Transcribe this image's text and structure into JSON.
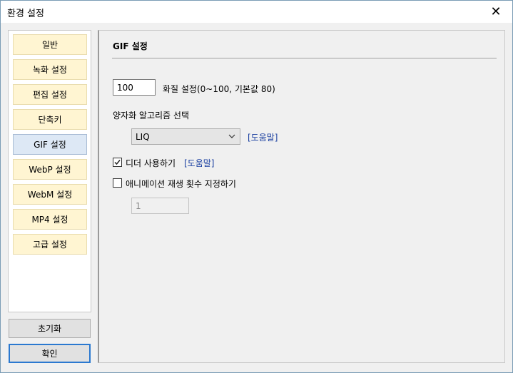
{
  "window": {
    "title": "환경 설정",
    "close_glyph": "✕"
  },
  "sidebar": {
    "items": [
      {
        "label": "일반",
        "active": false
      },
      {
        "label": "녹화 설정",
        "active": false
      },
      {
        "label": "편집 설정",
        "active": false
      },
      {
        "label": "단축키",
        "active": false
      },
      {
        "label": "GIF 설정",
        "active": true
      },
      {
        "label": "WebP 설정",
        "active": false
      },
      {
        "label": "WebM 설정",
        "active": false
      },
      {
        "label": "MP4 설정",
        "active": false
      },
      {
        "label": "고급 설정",
        "active": false
      }
    ],
    "reset_label": "초기화",
    "ok_label": "확인"
  },
  "main": {
    "section_title": "GIF 설정",
    "quality": {
      "value": "100",
      "label": "화질 설정(0~100, 기본값 80)"
    },
    "quantization": {
      "label": "양자화 알고리즘 선택",
      "selected": "LIQ",
      "help_label": "[도움말]"
    },
    "dither": {
      "checked": true,
      "label": "디더 사용하기",
      "help_label": "[도움말]"
    },
    "loop_count": {
      "checked": false,
      "label": "애니메이션 재생 횟수 지정하기",
      "value": "1"
    }
  },
  "colors": {
    "nav_bg": "#fff5d2",
    "nav_active_bg": "#dde8f5",
    "help_link": "#1a3fa0",
    "ok_border": "#2b79d0"
  }
}
